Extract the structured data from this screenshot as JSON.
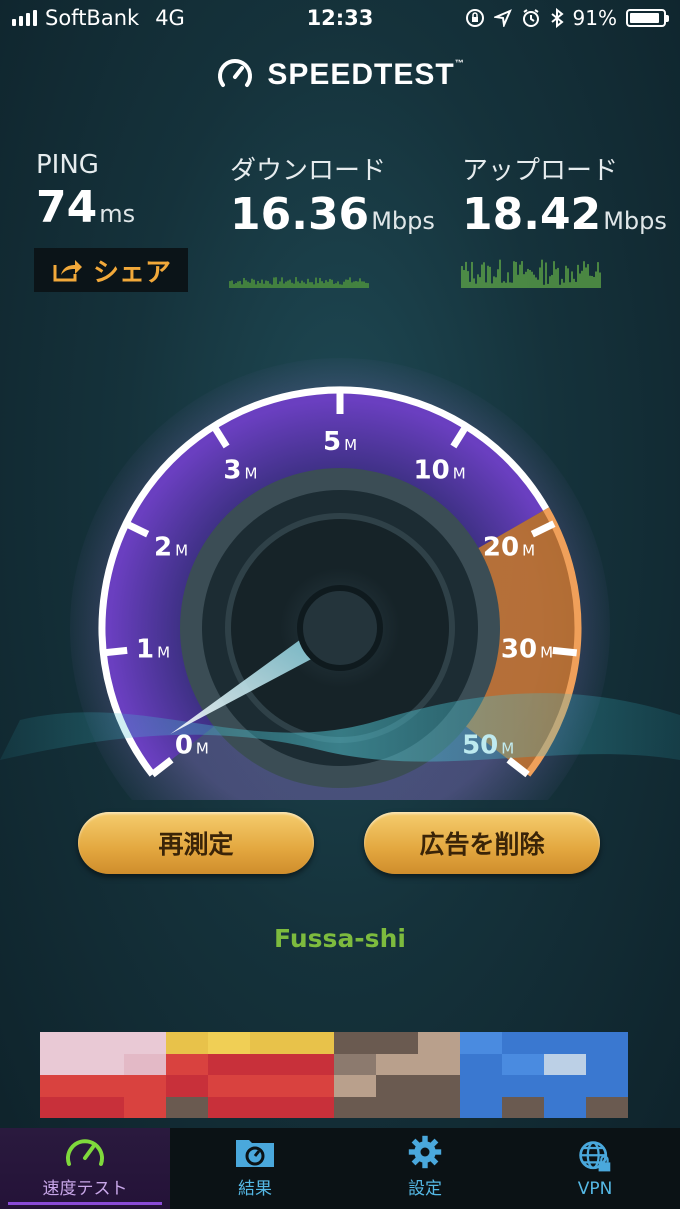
{
  "status_bar": {
    "carrier": "SoftBank",
    "network": "4G",
    "time": "12:33",
    "battery_percent": "91%",
    "battery_level": 0.91,
    "icons": [
      "orientation-lock-icon",
      "location-icon",
      "alarm-icon",
      "bluetooth-icon"
    ]
  },
  "app": {
    "brand": "SPEEDTEST",
    "trademark": "™"
  },
  "metrics": {
    "ping": {
      "label": "PING",
      "value": "74",
      "unit": "ms"
    },
    "download": {
      "label": "ダウンロード",
      "value": "16.36",
      "unit": "Mbps"
    },
    "upload": {
      "label": "アップロード",
      "value": "18.42",
      "unit": "Mbps"
    }
  },
  "share_label": "シェア",
  "gauge": {
    "ticks": [
      {
        "num": "0",
        "unit": "M"
      },
      {
        "num": "1",
        "unit": "M"
      },
      {
        "num": "2",
        "unit": "M"
      },
      {
        "num": "3",
        "unit": "M"
      },
      {
        "num": "5",
        "unit": "M"
      },
      {
        "num": "10",
        "unit": "M"
      },
      {
        "num": "20",
        "unit": "M"
      },
      {
        "num": "30",
        "unit": "M"
      },
      {
        "num": "50",
        "unit": "M"
      }
    ],
    "needle_value_mbps": 0,
    "colors": {
      "low": "#5b3bb0",
      "high": "#e0883a",
      "ring": "#ffffff"
    }
  },
  "buttons": {
    "retest": "再測定",
    "remove_ads": "広告を削除"
  },
  "location": "Fussa-shi",
  "tabs": [
    {
      "label": "速度テスト",
      "icon": "speedometer-icon",
      "active": true
    },
    {
      "label": "結果",
      "icon": "results-folder-icon",
      "active": false
    },
    {
      "label": "設定",
      "icon": "gear-icon",
      "active": false
    },
    {
      "label": "VPN",
      "icon": "globe-lock-icon",
      "active": false
    }
  ]
}
